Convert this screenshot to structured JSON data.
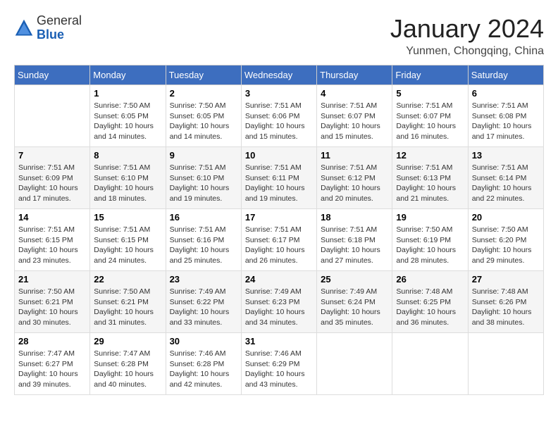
{
  "header": {
    "logo_general": "General",
    "logo_blue": "Blue",
    "month_title": "January 2024",
    "location": "Yunmen, Chongqing, China"
  },
  "days_of_week": [
    "Sunday",
    "Monday",
    "Tuesday",
    "Wednesday",
    "Thursday",
    "Friday",
    "Saturday"
  ],
  "weeks": [
    [
      {
        "day": "",
        "info": ""
      },
      {
        "day": "1",
        "info": "Sunrise: 7:50 AM\nSunset: 6:05 PM\nDaylight: 10 hours\nand 14 minutes."
      },
      {
        "day": "2",
        "info": "Sunrise: 7:50 AM\nSunset: 6:05 PM\nDaylight: 10 hours\nand 14 minutes."
      },
      {
        "day": "3",
        "info": "Sunrise: 7:51 AM\nSunset: 6:06 PM\nDaylight: 10 hours\nand 15 minutes."
      },
      {
        "day": "4",
        "info": "Sunrise: 7:51 AM\nSunset: 6:07 PM\nDaylight: 10 hours\nand 15 minutes."
      },
      {
        "day": "5",
        "info": "Sunrise: 7:51 AM\nSunset: 6:07 PM\nDaylight: 10 hours\nand 16 minutes."
      },
      {
        "day": "6",
        "info": "Sunrise: 7:51 AM\nSunset: 6:08 PM\nDaylight: 10 hours\nand 17 minutes."
      }
    ],
    [
      {
        "day": "7",
        "info": "Sunrise: 7:51 AM\nSunset: 6:09 PM\nDaylight: 10 hours\nand 17 minutes."
      },
      {
        "day": "8",
        "info": "Sunrise: 7:51 AM\nSunset: 6:10 PM\nDaylight: 10 hours\nand 18 minutes."
      },
      {
        "day": "9",
        "info": "Sunrise: 7:51 AM\nSunset: 6:10 PM\nDaylight: 10 hours\nand 19 minutes."
      },
      {
        "day": "10",
        "info": "Sunrise: 7:51 AM\nSunset: 6:11 PM\nDaylight: 10 hours\nand 19 minutes."
      },
      {
        "day": "11",
        "info": "Sunrise: 7:51 AM\nSunset: 6:12 PM\nDaylight: 10 hours\nand 20 minutes."
      },
      {
        "day": "12",
        "info": "Sunrise: 7:51 AM\nSunset: 6:13 PM\nDaylight: 10 hours\nand 21 minutes."
      },
      {
        "day": "13",
        "info": "Sunrise: 7:51 AM\nSunset: 6:14 PM\nDaylight: 10 hours\nand 22 minutes."
      }
    ],
    [
      {
        "day": "14",
        "info": "Sunrise: 7:51 AM\nSunset: 6:15 PM\nDaylight: 10 hours\nand 23 minutes."
      },
      {
        "day": "15",
        "info": "Sunrise: 7:51 AM\nSunset: 6:15 PM\nDaylight: 10 hours\nand 24 minutes."
      },
      {
        "day": "16",
        "info": "Sunrise: 7:51 AM\nSunset: 6:16 PM\nDaylight: 10 hours\nand 25 minutes."
      },
      {
        "day": "17",
        "info": "Sunrise: 7:51 AM\nSunset: 6:17 PM\nDaylight: 10 hours\nand 26 minutes."
      },
      {
        "day": "18",
        "info": "Sunrise: 7:51 AM\nSunset: 6:18 PM\nDaylight: 10 hours\nand 27 minutes."
      },
      {
        "day": "19",
        "info": "Sunrise: 7:50 AM\nSunset: 6:19 PM\nDaylight: 10 hours\nand 28 minutes."
      },
      {
        "day": "20",
        "info": "Sunrise: 7:50 AM\nSunset: 6:20 PM\nDaylight: 10 hours\nand 29 minutes."
      }
    ],
    [
      {
        "day": "21",
        "info": "Sunrise: 7:50 AM\nSunset: 6:21 PM\nDaylight: 10 hours\nand 30 minutes."
      },
      {
        "day": "22",
        "info": "Sunrise: 7:50 AM\nSunset: 6:21 PM\nDaylight: 10 hours\nand 31 minutes."
      },
      {
        "day": "23",
        "info": "Sunrise: 7:49 AM\nSunset: 6:22 PM\nDaylight: 10 hours\nand 33 minutes."
      },
      {
        "day": "24",
        "info": "Sunrise: 7:49 AM\nSunset: 6:23 PM\nDaylight: 10 hours\nand 34 minutes."
      },
      {
        "day": "25",
        "info": "Sunrise: 7:49 AM\nSunset: 6:24 PM\nDaylight: 10 hours\nand 35 minutes."
      },
      {
        "day": "26",
        "info": "Sunrise: 7:48 AM\nSunset: 6:25 PM\nDaylight: 10 hours\nand 36 minutes."
      },
      {
        "day": "27",
        "info": "Sunrise: 7:48 AM\nSunset: 6:26 PM\nDaylight: 10 hours\nand 38 minutes."
      }
    ],
    [
      {
        "day": "28",
        "info": "Sunrise: 7:47 AM\nSunset: 6:27 PM\nDaylight: 10 hours\nand 39 minutes."
      },
      {
        "day": "29",
        "info": "Sunrise: 7:47 AM\nSunset: 6:28 PM\nDaylight: 10 hours\nand 40 minutes."
      },
      {
        "day": "30",
        "info": "Sunrise: 7:46 AM\nSunset: 6:28 PM\nDaylight: 10 hours\nand 42 minutes."
      },
      {
        "day": "31",
        "info": "Sunrise: 7:46 AM\nSunset: 6:29 PM\nDaylight: 10 hours\nand 43 minutes."
      },
      {
        "day": "",
        "info": ""
      },
      {
        "day": "",
        "info": ""
      },
      {
        "day": "",
        "info": ""
      }
    ]
  ]
}
